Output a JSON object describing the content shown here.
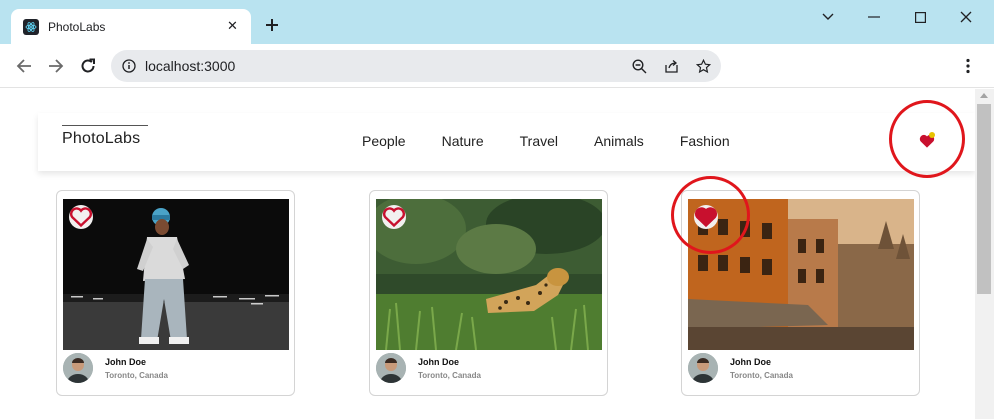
{
  "browser": {
    "tab_title": "PhotoLabs",
    "url": "localhost:3000"
  },
  "app": {
    "logo": "PhotoLabs",
    "topics": [
      "People",
      "Nature",
      "Travel",
      "Animals",
      "Fashion"
    ],
    "fav_notification": true
  },
  "photos": [
    {
      "user": "John Doe",
      "location": "Toronto, Canada",
      "liked": false,
      "subject": "person-at-night"
    },
    {
      "user": "John Doe",
      "location": "Toronto, Canada",
      "liked": false,
      "subject": "jaguar-in-grass"
    },
    {
      "user": "John Doe",
      "location": "Toronto, Canada",
      "liked": true,
      "subject": "old-city-buildings"
    }
  ],
  "colors": {
    "tabstrip": "#b9e3f0",
    "like_red": "#c8102e",
    "annotation_red": "#e0161c",
    "notification_yellow": "#e8c200"
  }
}
